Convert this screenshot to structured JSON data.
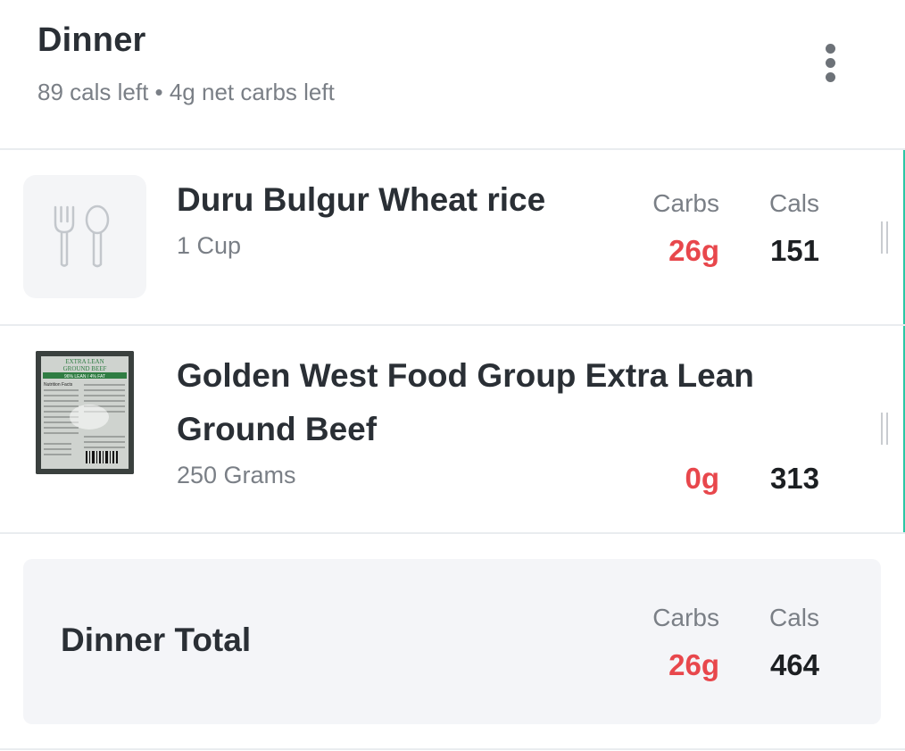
{
  "meal": {
    "title": "Dinner",
    "subtitle": "89 cals left • 4g net carbs left",
    "menu_icon": "more-vertical-icon"
  },
  "columns": {
    "carbs_label": "Carbs",
    "cals_label": "Cals"
  },
  "items": [
    {
      "name": "Duru Bulgur Wheat rice",
      "serving": "1 Cup",
      "carbs": "26g",
      "cals": "151",
      "thumbnail_icon": "fork-spoon-icon"
    },
    {
      "name": "Golden West Food Group Extra Lean Ground Beef",
      "serving": "250 Grams",
      "carbs": "0g",
      "cals": "313",
      "thumbnail": "photo",
      "photo_label": {
        "line1": "EXTRA LEAN",
        "line2": "GROUND BEEF",
        "line3": "96% LEAN / 4% FAT",
        "panel": "Nutrition Facts"
      }
    }
  ],
  "total": {
    "label": "Dinner Total",
    "carbs": "26g",
    "cals": "464"
  },
  "colors": {
    "carbs": "#e8474c",
    "accent": "#2bc7a5",
    "muted": "#7a7f86",
    "text": "#2a2f35"
  }
}
